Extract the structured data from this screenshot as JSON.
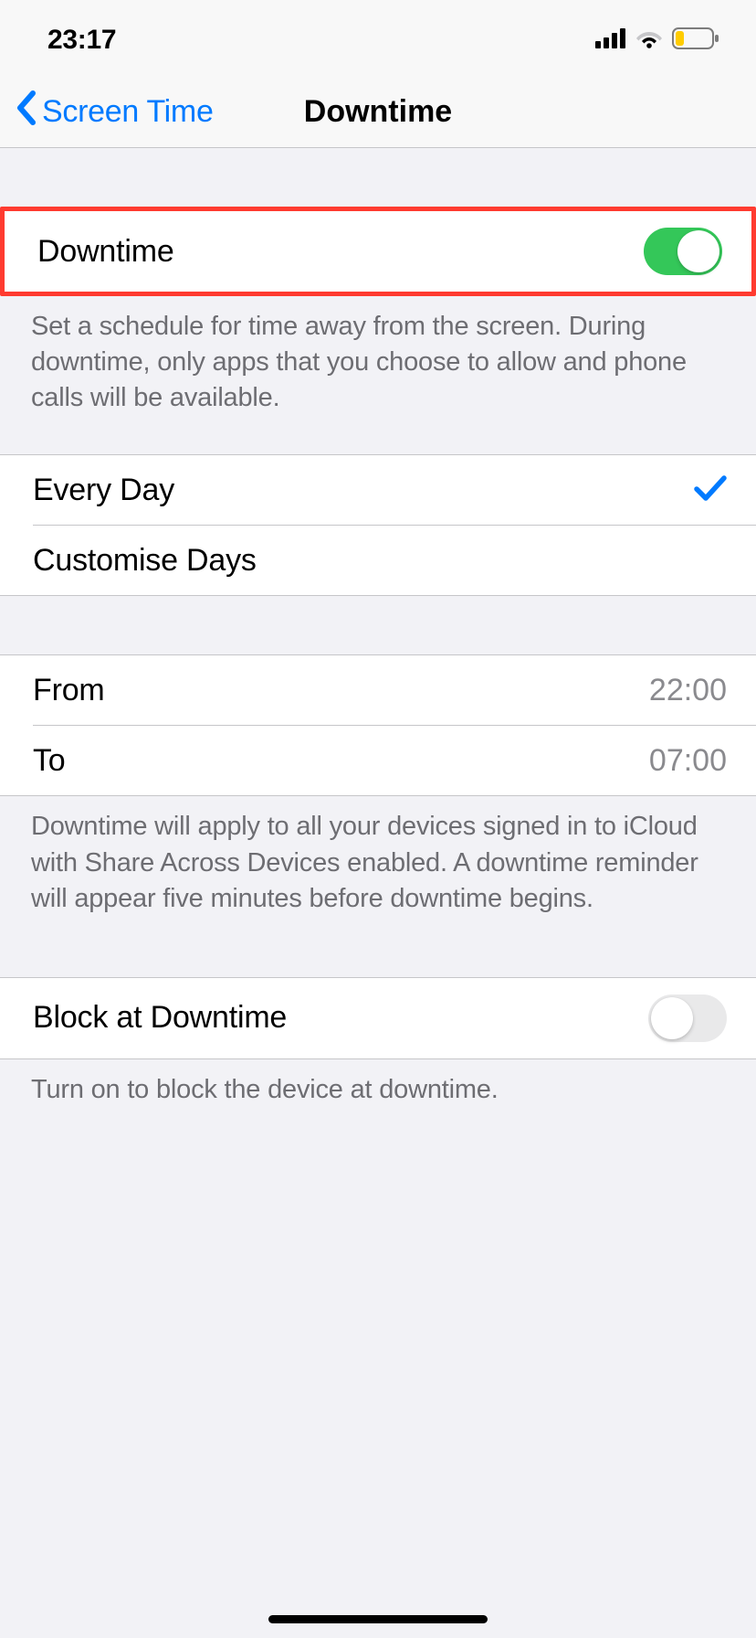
{
  "statusbar": {
    "time": "23:17"
  },
  "nav": {
    "back_label": "Screen Time",
    "title": "Downtime"
  },
  "downtime": {
    "label": "Downtime",
    "enabled": true,
    "description": "Set a schedule for time away from the screen. During downtime, only apps that you choose to allow and phone calls will be available."
  },
  "schedule": {
    "every_day_label": "Every Day",
    "every_day_selected": true,
    "customise_label": "Customise Days"
  },
  "time": {
    "from_label": "From",
    "from_value": "22:00",
    "to_label": "To",
    "to_value": "07:00",
    "footer": "Downtime will apply to all your devices signed in to iCloud with Share Across Devices enabled. A downtime reminder will appear five minutes before downtime begins."
  },
  "block": {
    "label": "Block at Downtime",
    "enabled": false,
    "footer": "Turn on to block the device at downtime."
  }
}
